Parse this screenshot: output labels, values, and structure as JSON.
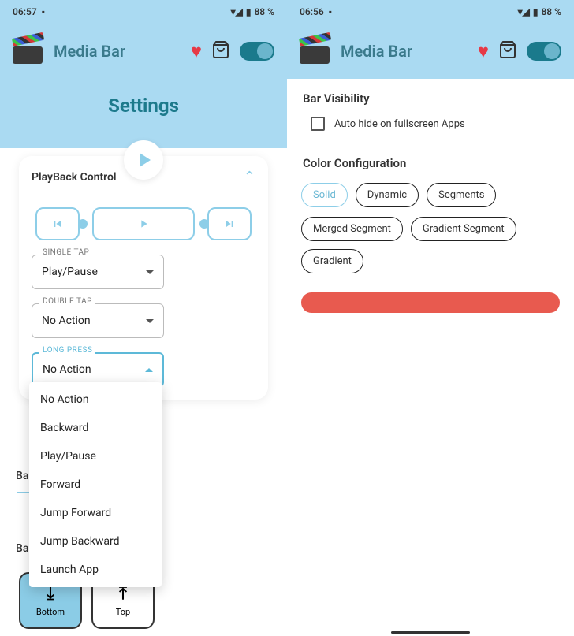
{
  "left": {
    "status": {
      "time": "06:57",
      "battery": "88 %"
    },
    "app_title": "Media Bar",
    "page_title": "Settings",
    "card_title": "PlayBack Control",
    "single_tap_label": "SINGLE TAP",
    "single_tap_value": "Play/Pause",
    "double_tap_label": "DOUBLE TAP",
    "double_tap_value": "No Action",
    "long_press_label": "LONG PRESS",
    "long_press_value": "No Action",
    "dropdown": [
      "No Action",
      "Backward",
      "Play/Pause",
      "Forward",
      "Jump Forward",
      "Jump Backward",
      "Launch App"
    ],
    "bar_label_1": "Bar",
    "bar_label_2": "Bar",
    "pos_bottom": "Bottom",
    "pos_top": "Top"
  },
  "right": {
    "status": {
      "time": "06:56",
      "battery": "88 %"
    },
    "app_title": "Media Bar",
    "section_visibility": "Bar Visibility",
    "auto_hide": "Auto hide on fullscreen Apps",
    "section_color": "Color Configuration",
    "chips": [
      "Solid",
      "Dynamic",
      "Segments",
      "Merged Segment",
      "Gradient Segment",
      "Gradient"
    ],
    "preview_color": "#e85a4f"
  }
}
